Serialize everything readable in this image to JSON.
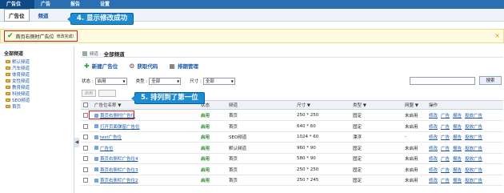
{
  "topnav": {
    "tabs": [
      {
        "label": "广告位",
        "active": true
      },
      {
        "label": "广告"
      },
      {
        "label": "报告"
      },
      {
        "label": "设置"
      }
    ]
  },
  "subnav": {
    "tabs": [
      {
        "label": "广告位",
        "active": true
      },
      {
        "label": "频道"
      }
    ]
  },
  "callouts": {
    "success": "4. 显示修改成功",
    "first": "5. 排列到了第一位"
  },
  "notice": {
    "message": "首页右侧时广告位",
    "detail": "修改完成!",
    "close": "×"
  },
  "sidebar": {
    "title": "全部频道",
    "items": [
      "默认频道",
      "汽车频道",
      "体育频道",
      "女性频道",
      "教育频道",
      "科技频道",
      "SEO频道",
      "首页"
    ]
  },
  "crumb": {
    "prefix": "频道 :",
    "current": "全部频道"
  },
  "actions": {
    "new": "新建广告位",
    "code": "获取代码",
    "sort": "排期管理"
  },
  "filters": {
    "status_label": "状态 :",
    "status_value": "启用",
    "type_label": "类型 :",
    "type_value": "全部",
    "size_label": "尺寸 :",
    "size_value": "全部",
    "search_button": "搜索"
  },
  "bulk": {
    "enable": "启用",
    "disable": ""
  },
  "table": {
    "headers": {
      "name": "广告位名称 ▼",
      "status": "状态",
      "channel": "频道",
      "size": "尺寸 ▼",
      "type": "类型 ▼",
      "weekend": "网盟 ▼",
      "ops": "操作"
    },
    "rows": [
      {
        "name": "首页右侧时广告位",
        "status": "启用",
        "channel": "首页",
        "size": "250 * 250",
        "type": "固定",
        "weekend": "未启用",
        "ops": [
          "修改",
          "广告",
          "报告",
          "投放广告"
        ]
      },
      {
        "name": "打开页面弹窗广告位",
        "status": "启用",
        "channel": "首页",
        "size": "640 * 60",
        "type": "固定",
        "weekend": "未启用",
        "ops": [
          "修改",
          "广告",
          "报告",
          "投放广告"
        ]
      },
      {
        "name": "test广告位",
        "status": "启用",
        "channel": "SEO频道",
        "size": "1024 * 60",
        "type": "漂浮",
        "weekend": "-",
        "ops": [
          "修改",
          "广告",
          "报告",
          "投放广告"
        ]
      },
      {
        "name": "广告位",
        "status": "启用",
        "channel": "默认频道",
        "size": "960 * 90",
        "type": "固定",
        "weekend": "未启用",
        "ops": [
          "修改",
          "广告",
          "报告",
          "投放广告"
        ]
      },
      {
        "name": "首页右侧栏广告位4",
        "status": "启用",
        "channel": "首页",
        "size": "580 * 90",
        "type": "固定",
        "weekend": "未启用",
        "ops": [
          "修改",
          "广告",
          "报告",
          "投放广告"
        ]
      },
      {
        "name": "首页右侧栏广告位3",
        "status": "启用",
        "channel": "首页",
        "size": "250 * 250",
        "type": "固定",
        "weekend": "未启用",
        "ops": [
          "修改",
          "广告",
          "报告",
          "投放广告"
        ]
      },
      {
        "name": "首页右侧栏广告位2",
        "status": "启用",
        "channel": "首页",
        "size": "250 * 245",
        "type": "固定",
        "weekend": "未启用",
        "ops": [
          "修改",
          "广告",
          "报告",
          "投放广告"
        ]
      }
    ]
  }
}
